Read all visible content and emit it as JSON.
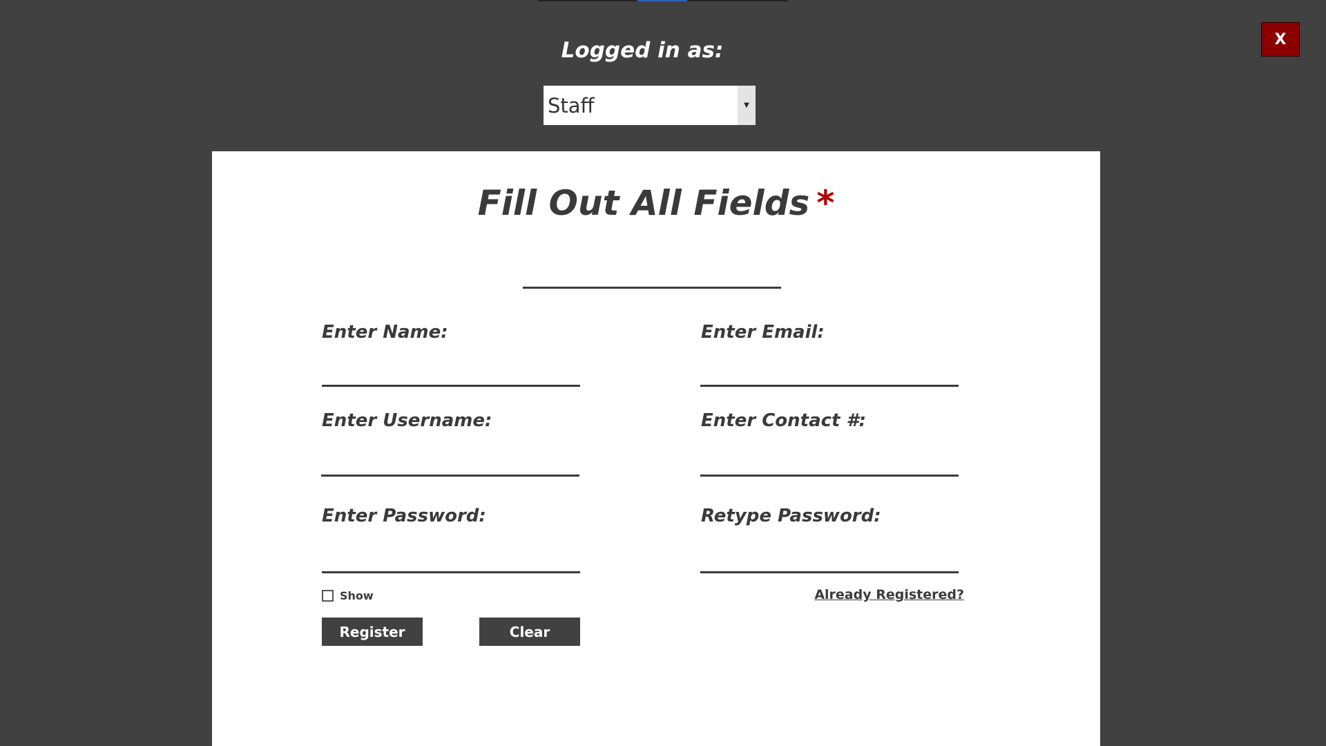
{
  "header": {
    "logged_in_label": "Logged in as:",
    "role_select": {
      "value": "Staff"
    },
    "close_label": "X"
  },
  "form": {
    "title": "Fill Out All Fields",
    "required_marker": "*",
    "fields": {
      "name": {
        "label": "Enter Name:",
        "value": ""
      },
      "email": {
        "label": "Enter Email:",
        "value": ""
      },
      "username": {
        "label": "Enter Username:",
        "value": ""
      },
      "contact": {
        "label": "Enter Contact #:",
        "value": ""
      },
      "password": {
        "label": "Enter Password:",
        "value": ""
      },
      "retype_password": {
        "label": "Retype Password:",
        "value": ""
      }
    },
    "show_password": {
      "label": "Show",
      "checked": false
    },
    "already_registered_link": "Already Registered?",
    "register_button": "Register",
    "clear_button": "Clear"
  },
  "colors": {
    "background": "#414141",
    "panel": "#ffffff",
    "close_button": "#8b0000",
    "required_star": "#b00000",
    "accent_line": "#2a63b8"
  },
  "icons": {
    "close": "close-icon",
    "dropdown": "chevron-down-icon"
  }
}
